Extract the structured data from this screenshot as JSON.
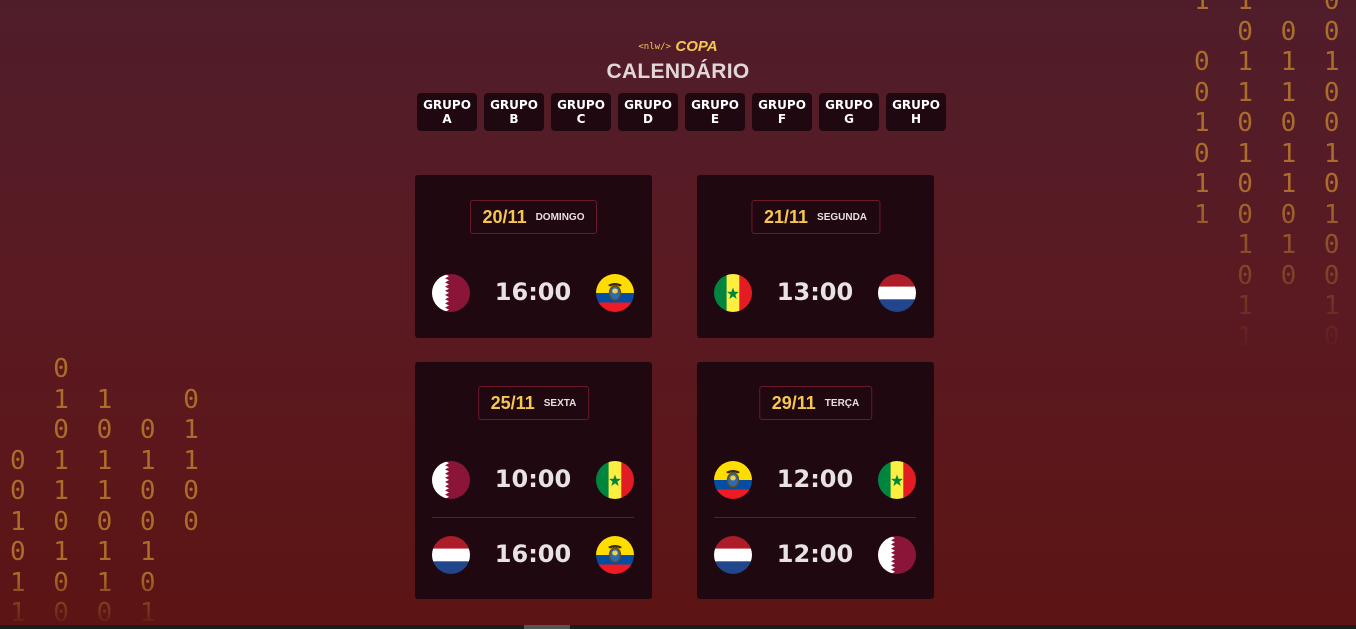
{
  "background_binary": {
    "right": "1 1   0\n  0 0 0 1\n0 1 1 1 1\n0 1 1 0 0\n1 0 0 0 0\n0 1 1 1\n1 0 1 0\n1 0 0 1\n  1 1 0\n  0 0 0\n  1   1\n  1   0",
    "left": "  0\n  1 1   0\n  0 0 0 1\n0 1 1 1 1\n0 1 1 0 0\n1 0 0 0 0\n0 1 1 1\n1 0 1 0\n1 0 0 1"
  },
  "header": {
    "logo_prefix": "<nlw/>",
    "logo_name": "COPA",
    "title": "CALENDÁRIO"
  },
  "groups": [
    {
      "word": "GRUPO",
      "letter": "A"
    },
    {
      "word": "GRUPO",
      "letter": "B"
    },
    {
      "word": "GRUPO",
      "letter": "C"
    },
    {
      "word": "GRUPO",
      "letter": "D"
    },
    {
      "word": "GRUPO",
      "letter": "E"
    },
    {
      "word": "GRUPO",
      "letter": "F"
    },
    {
      "word": "GRUPO",
      "letter": "G"
    },
    {
      "word": "GRUPO",
      "letter": "H"
    }
  ],
  "cards": [
    {
      "date": "20/11",
      "weekday": "DOMINGO",
      "matches": [
        {
          "home": "qatar-flag-icon",
          "time": "16:00",
          "away": "ecuador-flag-icon"
        }
      ]
    },
    {
      "date": "21/11",
      "weekday": "SEGUNDA",
      "matches": [
        {
          "home": "senegal-flag-icon",
          "time": "13:00",
          "away": "netherlands-flag-icon"
        }
      ]
    },
    {
      "date": "25/11",
      "weekday": "SEXTA",
      "matches": [
        {
          "home": "qatar-flag-icon",
          "time": "10:00",
          "away": "senegal-flag-icon"
        },
        {
          "home": "netherlands-flag-icon",
          "time": "16:00",
          "away": "ecuador-flag-icon"
        }
      ]
    },
    {
      "date": "29/11",
      "weekday": "TERÇA",
      "matches": [
        {
          "home": "ecuador-flag-icon",
          "time": "12:00",
          "away": "senegal-flag-icon"
        },
        {
          "home": "netherlands-flag-icon",
          "time": "12:00",
          "away": "qatar-flag-icon"
        }
      ]
    }
  ],
  "colors": {
    "accent": "#f6c750",
    "card": "#200811",
    "binary": "#c9892f",
    "qatar": "#8a1538",
    "senegal_green": "#00853f",
    "senegal_yellow": "#fdef42",
    "senegal_red": "#e31b23",
    "ecuador_yellow": "#ffdd00",
    "ecuador_blue": "#034ea2",
    "ecuador_red": "#ed1c24",
    "netherlands_red": "#ae1c28",
    "netherlands_blue": "#21468b"
  }
}
